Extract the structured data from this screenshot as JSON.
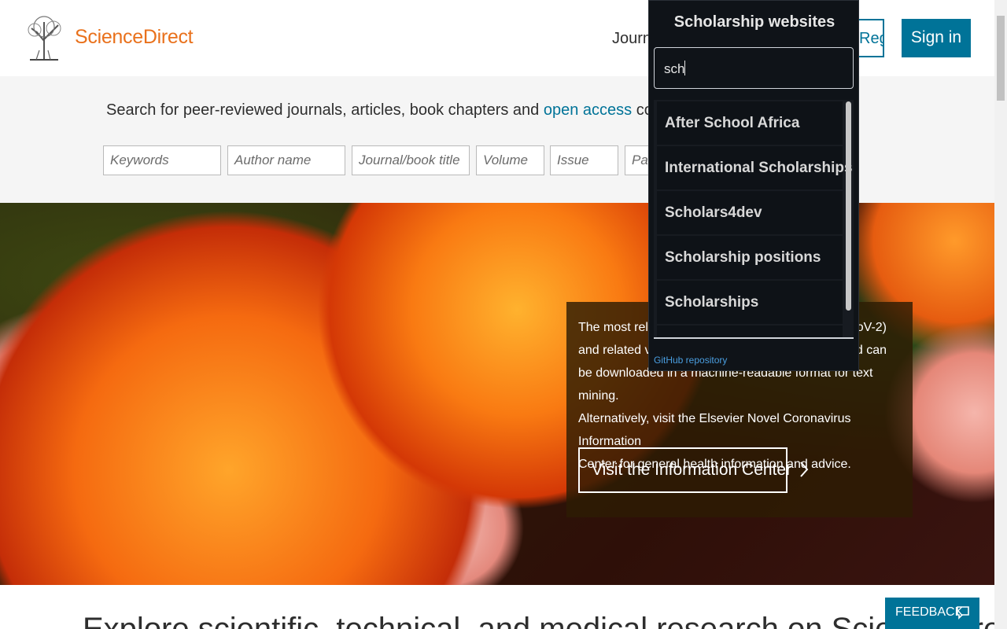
{
  "header": {
    "brand": "ScienceDirect",
    "nav_journals": "Journals",
    "register": "Register",
    "sign_in": "Sign in"
  },
  "search": {
    "intro_before": "Search for peer-reviewed journals, articles, book chapters and ",
    "intro_link": "open access",
    "intro_after": " content.",
    "fields": {
      "keywords": "Keywords",
      "author": "Author name",
      "journal": "Journal/book title",
      "volume": "Volume",
      "issue": "Issue",
      "pages": "Pages"
    }
  },
  "hero": {
    "line1": "The most relevant",
    "line1_end": "oV-2)",
    "line2": "and related vir",
    "line2_end": "nd can",
    "line3": "be downloaded in a machine-readable format for text mining.",
    "line4": "Alternatively, visit the Elsevier Novel Coronavirus Information",
    "line5": "Center for general health information and advice.",
    "cta": "Visit the Information Center"
  },
  "popup": {
    "title": "Scholarship websites",
    "query": "sch",
    "results": [
      "After School Africa",
      "International Scholarships",
      "Scholars4dev",
      "Scholarship positions",
      "Scholarships"
    ],
    "link": "GitHub repository"
  },
  "bottom": {
    "headline": "Explore scientific, technical, and medical research on ScienceDirect",
    "feedback": "FEEDBACK"
  },
  "icons": {
    "feedback": "speech-bubble-icon",
    "cta": "chevron-right-icon",
    "logo": "elsevier-tree-logo"
  },
  "colors": {
    "brand_orange": "#e9711c",
    "primary_blue": "#007398",
    "popup_bg": "#0f1318"
  }
}
